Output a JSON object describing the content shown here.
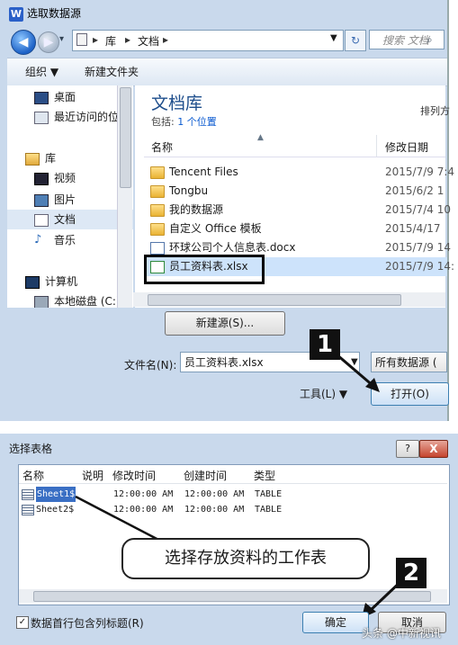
{
  "dialog1": {
    "title": "选取数据源",
    "app_icon": "W",
    "address": [
      "库",
      "文档"
    ],
    "search_placeholder": "搜索 文档",
    "toolbar": {
      "organize": "组织 ▼",
      "new_folder": "新建文件夹"
    },
    "nav": [
      {
        "label": "桌面",
        "icon": "desktop-icon"
      },
      {
        "label": "最近访问的位",
        "icon": "recent-icon"
      },
      {
        "label": "库",
        "icon": "library-icon"
      },
      {
        "label": "视频",
        "icon": "video-icon"
      },
      {
        "label": "图片",
        "icon": "picture-icon"
      },
      {
        "label": "文档",
        "icon": "document-icon"
      },
      {
        "label": "音乐",
        "icon": "music-icon"
      },
      {
        "label": "计算机",
        "icon": "computer-icon"
      },
      {
        "label": "本地磁盘 (C:)",
        "icon": "disk-icon"
      }
    ],
    "library": {
      "title": "文档库",
      "includes_label": "包括:",
      "includes_link": "1 个位置",
      "arrange": "排列方"
    },
    "columns": {
      "name": "名称",
      "date": "修改日期"
    },
    "files": [
      {
        "name": "Tencent Files",
        "date": "2015/7/9 7:4",
        "type": "folder"
      },
      {
        "name": "Tongbu",
        "date": "2015/6/2 1",
        "type": "folder"
      },
      {
        "name": "我的数据源",
        "date": "2015/7/4 10",
        "type": "folder"
      },
      {
        "name": "自定义 Office 模板",
        "date": "2015/4/17",
        "type": "folder"
      },
      {
        "name": "环球公司个人信息表.docx",
        "date": "2015/7/9 14",
        "type": "doc"
      },
      {
        "name": "员工资料表.xlsx",
        "date": "2015/7/9 14:",
        "type": "xls"
      }
    ],
    "new_source": "新建源(S)...",
    "filename_label": "文件名(N):",
    "filename_value": "员工资料表.xlsx",
    "filter": "所有数据源 (",
    "tools": "工具(L)  ▼",
    "open": "打开(O)",
    "step_badge": "1"
  },
  "dialog2": {
    "title": "选择表格",
    "help": "?",
    "close": "X",
    "columns": [
      "名称",
      "说明",
      "修改时间",
      "创建时间",
      "类型"
    ],
    "rows": [
      {
        "name": "Sheet1$",
        "desc": "",
        "modified": "12:00:00 AM",
        "created": "12:00:00 AM",
        "type": "TABLE"
      },
      {
        "name": "Sheet2$",
        "desc": "",
        "modified": "12:00:00 AM",
        "created": "12:00:00 AM",
        "type": "TABLE"
      }
    ],
    "callout": "选择存放资料的工作表",
    "step_badge": "2",
    "header_checkbox": "数据首行包含列标题(R)",
    "ok": "确定",
    "cancel": "取消",
    "watermark": "头条 @中新视讯"
  }
}
